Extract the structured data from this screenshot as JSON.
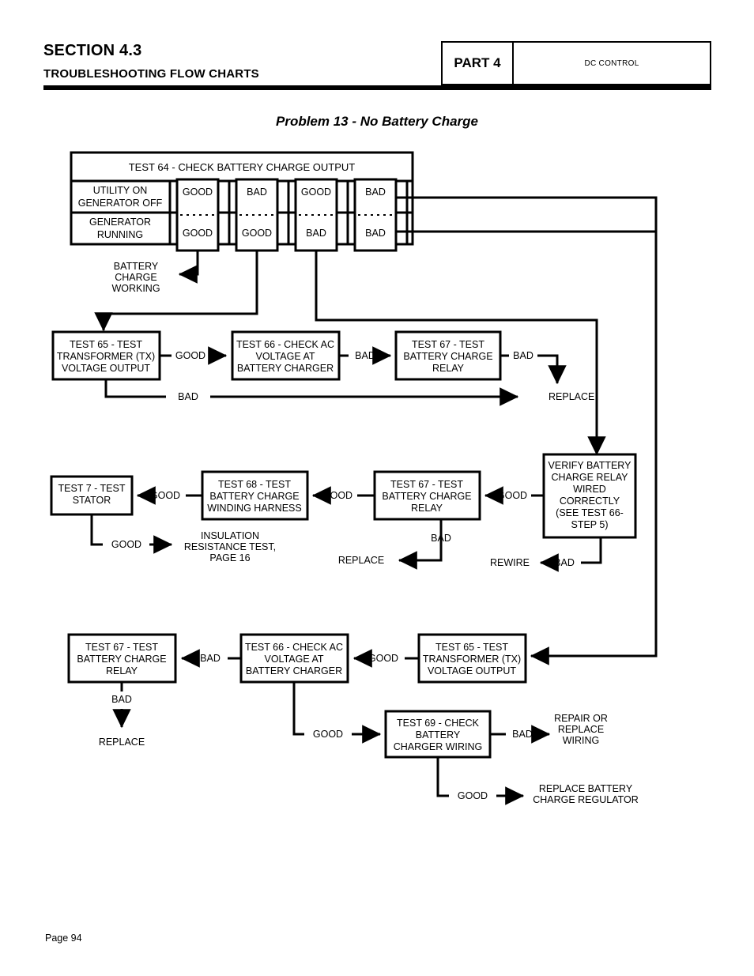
{
  "header": {
    "section_title": "SECTION 4.3",
    "section_subtitle": "TROUBLESHOOTING FLOW CHARTS",
    "part_label": "PART 4",
    "part_name": "DC CONTROL"
  },
  "problem_title": "Problem 13 - No Battery Charge",
  "footer": {
    "page_label": "Page 94"
  },
  "matrix": {
    "title": "TEST 64 - CHECK BATTERY CHARGE OUTPUT",
    "row1_label_line1": "UTILITY ON",
    "row1_label_line2": "GENERATOR OFF",
    "row2_label_line1": "GENERATOR",
    "row2_label_line2": "RUNNING",
    "columns": [
      {
        "top": "GOOD",
        "bottom": "GOOD"
      },
      {
        "top": "BAD",
        "bottom": "GOOD"
      },
      {
        "top": "GOOD",
        "bottom": "BAD"
      },
      {
        "top": "BAD",
        "bottom": "BAD"
      }
    ]
  },
  "outcomes": {
    "battery_charge_working_l1": "BATTERY",
    "battery_charge_working_l2": "CHARGE",
    "battery_charge_working_l3": "WORKING",
    "replace_row2": "REPLACE",
    "replace_row3": "REPLACE",
    "rewire": "REWIRE",
    "replace_row4": "REPLACE",
    "insulation_l1": "INSULATION",
    "insulation_l2": "RESISTANCE TEST,",
    "insulation_l3": "PAGE 16",
    "repair_wiring_l1": "REPAIR OR",
    "repair_wiring_l2": "REPLACE",
    "repair_wiring_l3": "WIRING",
    "replace_regulator_l1": "REPLACE BATTERY",
    "replace_regulator_l2": "CHARGE REGULATOR"
  },
  "boxes": {
    "test65_r2_l1": "TEST 65 - TEST",
    "test65_r2_l2": "TRANSFORMER (TX)",
    "test65_r2_l3": "VOLTAGE OUTPUT",
    "test66_r2_l1": "TEST 66 - CHECK AC",
    "test66_r2_l2": "VOLTAGE AT",
    "test66_r2_l3": "BATTERY CHARGER",
    "test67_r2_l1": "TEST 67 - TEST",
    "test67_r2_l2": "BATTERY CHARGE",
    "test67_r2_l3": "RELAY",
    "test7_r3_l1": "TEST 7 - TEST",
    "test7_r3_l2": "STATOR",
    "test68_r3_l1": "TEST 68 - TEST",
    "test68_r3_l2": "BATTERY CHARGE",
    "test68_r3_l3": "WINDING HARNESS",
    "test67_r3_l1": "TEST 67 - TEST",
    "test67_r3_l2": "BATTERY CHARGE",
    "test67_r3_l3": "RELAY",
    "verify_l1": "VERIFY BATTERY",
    "verify_l2": "CHARGE RELAY",
    "verify_l3": "WIRED",
    "verify_l4": "CORRECTLY",
    "verify_l5": "(SEE TEST 66-",
    "verify_l6": "STEP 5)",
    "test67_r4_l1": "TEST 67 - TEST",
    "test67_r4_l2": "BATTERY CHARGE",
    "test67_r4_l3": "RELAY",
    "test66_r4_l1": "TEST 66 - CHECK AC",
    "test66_r4_l2": "VOLTAGE AT",
    "test66_r4_l3": "BATTERY CHARGER",
    "test65_r4_l1": "TEST 65 - TEST",
    "test65_r4_l2": "TRANSFORMER (TX)",
    "test65_r4_l3": "VOLTAGE OUTPUT",
    "test69_r4_l1": "TEST 69 - CHECK",
    "test69_r4_l2": "BATTERY",
    "test69_r4_l3": "CHARGER WIRING"
  },
  "edges": {
    "r2_65_to_66": "GOOD",
    "r2_66_to_67": "BAD",
    "r2_67_bad": "BAD",
    "r2_65_bad": "BAD",
    "r3_68_to_7": "GOOD",
    "r3_67_to_68": "GOOD",
    "r3_verify_to_67": "GOOD",
    "r3_7_good": "GOOD",
    "r3_67_bad": "BAD",
    "r3_verify_bad": "BAD",
    "r4_66_to_67": "BAD",
    "r4_65_to_66": "GOOD",
    "r4_67_bad": "BAD",
    "r4_66_good": "GOOD",
    "r4_69_bad": "BAD",
    "r4_69_good": "GOOD"
  }
}
